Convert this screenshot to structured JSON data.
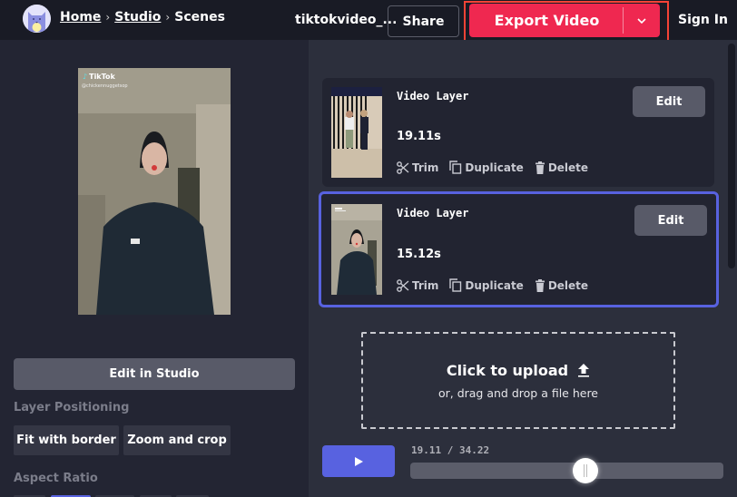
{
  "header": {
    "logo": "cat-avatar-logo",
    "breadcrumb": [
      {
        "label": "Home",
        "link": true
      },
      {
        "label": "Studio",
        "link": true
      },
      {
        "label": "Scenes",
        "link": false
      }
    ],
    "breadcrumb_separator": "›",
    "project_name": "tiktokvideo_...",
    "share_label": "Share",
    "export_label": "Export Video",
    "export_caret_icon": "chevron-down-icon",
    "signin_label": "Sign In",
    "colors": {
      "export": "#ef2850",
      "export_highlight_outline": "#f44336",
      "accent": "#5862e0"
    }
  },
  "left_panel": {
    "preview": {
      "watermark_brand": "TikTok",
      "watermark_handle": "@chickennuggetsop"
    },
    "edit_in_studio_label": "Edit in Studio",
    "layer_positioning": {
      "label": "Layer Positioning",
      "options": [
        "Fit with border",
        "Zoom and crop"
      ]
    },
    "aspect_ratio": {
      "label": "Aspect Ratio",
      "selected_index": 1
    }
  },
  "layers": [
    {
      "title": "Video Layer",
      "duration": "19.11s",
      "selected": false,
      "edit_label": "Edit",
      "actions": [
        {
          "label": "Trim",
          "icon": "scissors-icon"
        },
        {
          "label": "Duplicate",
          "icon": "copy-icon"
        },
        {
          "label": "Delete",
          "icon": "trash-icon"
        }
      ]
    },
    {
      "title": "Video Layer",
      "duration": "15.12s",
      "selected": true,
      "edit_label": "Edit",
      "actions": [
        {
          "label": "Trim",
          "icon": "scissors-icon"
        },
        {
          "label": "Duplicate",
          "icon": "copy-icon"
        },
        {
          "label": "Delete",
          "icon": "trash-icon"
        }
      ]
    }
  ],
  "upload": {
    "title": "Click to upload",
    "icon": "upload-icon",
    "subtitle": "or, drag and drop a file here"
  },
  "playback": {
    "play_icon": "play-icon",
    "timecode": "19.11 / 34.22",
    "current_seconds": 19.11,
    "total_seconds": 34.22
  }
}
